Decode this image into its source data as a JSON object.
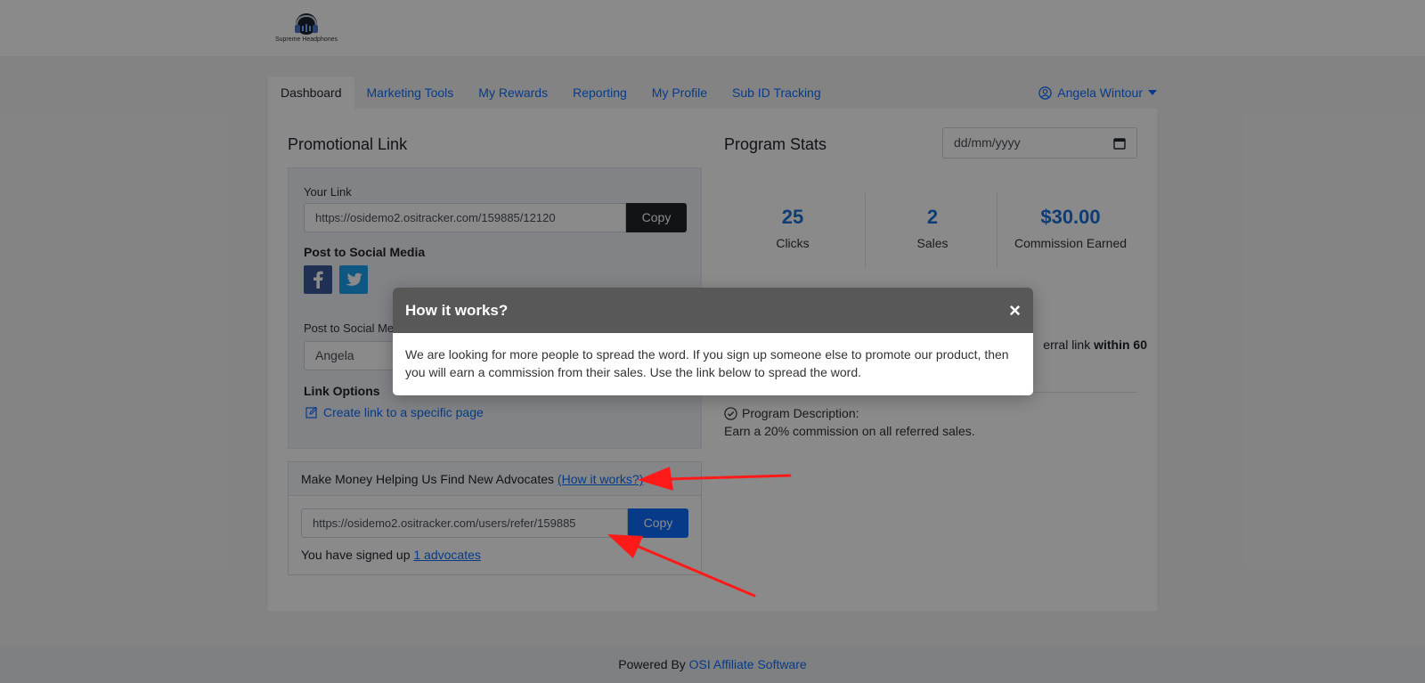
{
  "brand": {
    "name": "Supreme Headphones",
    "logo_icon": "headphones-logo"
  },
  "nav": {
    "tabs": [
      {
        "label": "Dashboard",
        "active": true
      },
      {
        "label": "Marketing Tools"
      },
      {
        "label": "My Rewards"
      },
      {
        "label": "Reporting"
      },
      {
        "label": "My Profile"
      },
      {
        "label": "Sub ID Tracking"
      }
    ],
    "user": "Angela Wintour"
  },
  "promo": {
    "title": "Promotional Link",
    "your_link_label": "Your Link",
    "your_link_value": "https://osidemo2.ositracker.com/159885/12120",
    "copy_label": "Copy",
    "social_label": "Post to Social Media",
    "social_msg_label": "Post to Social Media",
    "social_msg_value": "Angela",
    "link_options_label": "Link Options",
    "create_link_label": "Create link to a specific page"
  },
  "refer": {
    "head_text": "Make Money Helping Us Find New Advocates ",
    "how_link": "(How it works?)",
    "link_value": "https://osidemo2.ositracker.com/users/refer/159885",
    "copy_label": "Copy",
    "signed_text": "You have signed up ",
    "advocates_link": "1 advocates"
  },
  "stats": {
    "title": "Program Stats",
    "date_placeholder": "dd/mm/yyyy",
    "items": [
      {
        "value": "25",
        "label": "Clicks"
      },
      {
        "value": "2",
        "label": "Sales"
      },
      {
        "value": "$30.00",
        "label": "Commission Earned"
      }
    ],
    "ref_fragment_plain": "erral link ",
    "ref_fragment_bold": "within 60",
    "desc_title": "Program Description:",
    "desc_text": "Earn a 20% commission on all referred sales."
  },
  "footer": {
    "prefix": "Powered By ",
    "link": "OSI Affiliate Software"
  },
  "modal": {
    "title": "How it works?",
    "close": "×",
    "body": "We are looking for more people to spread the word. If you sign up someone else to promote our product, then you will earn a commission from their sales. Use the link below to spread the word."
  },
  "colors": {
    "accent": "#0d6efd",
    "annotation": "#ff1a1a",
    "modal_header": "#585858"
  }
}
